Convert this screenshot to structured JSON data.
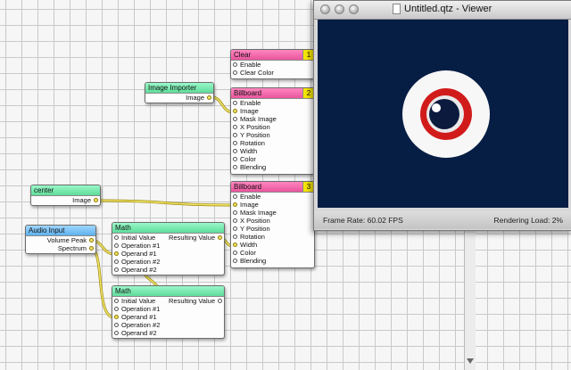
{
  "viewer": {
    "title": "Untitled.qtz - Viewer",
    "frame_rate": "Frame Rate:  60.02 FPS",
    "rendering_load": "Rendering Load:  2%"
  },
  "patches": {
    "clear": {
      "title": "Clear",
      "layer": "1",
      "inputs": [
        "Enable",
        "Clear Color"
      ]
    },
    "image_importer": {
      "title": "Image Importer",
      "outputs": [
        "Image"
      ]
    },
    "billboard2": {
      "title": "Billboard",
      "layer": "2",
      "inputs": [
        "Enable",
        "Image",
        "Mask Image",
        "X Position",
        "Y Position",
        "Rotation",
        "Width",
        "Color",
        "Blending"
      ]
    },
    "center": {
      "title": "center",
      "outputs": [
        "Image"
      ]
    },
    "billboard3": {
      "title": "Billboard",
      "layer": "3",
      "inputs": [
        "Enable",
        "Image",
        "Mask Image",
        "X Position",
        "Y Position",
        "Rotation",
        "Width",
        "Color",
        "Blending"
      ]
    },
    "audio_input": {
      "title": "Audio Input",
      "outputs": [
        "Volume Peak",
        "Spectrum"
      ]
    },
    "math1": {
      "title": "Math",
      "inputs": [
        "Initial Value",
        "Operation #1",
        "Operand #1",
        "Operation #2",
        "Operand #2"
      ],
      "output": "Resulting Value"
    },
    "math2": {
      "title": "Math",
      "inputs": [
        "Initial Value",
        "Operation #1",
        "Operand #1",
        "Operation #2",
        "Operand #2"
      ],
      "output": "Resulting Value"
    }
  },
  "colors": {
    "wire": "#e8d64a",
    "viewer_bg": "#061d44",
    "eye_red": "#d11b1b"
  }
}
